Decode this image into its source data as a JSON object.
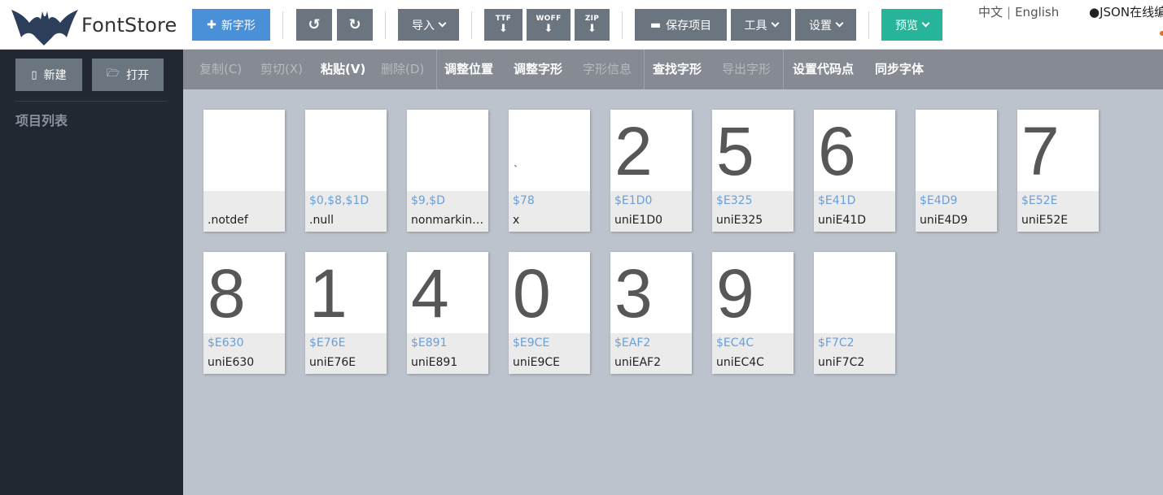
{
  "brand": {
    "name": "FontStore"
  },
  "toolbar": {
    "new_glyph": "新字形",
    "import": "导入",
    "ttf": "TTF",
    "woff": "WOFF",
    "zip": "ZIP",
    "save_project": "保存项目",
    "tools": "工具",
    "settings": "设置",
    "preview": "预览",
    "lang_zh": "中文",
    "lang_sep": "|",
    "lang_en": "English",
    "json_link": "JSON在线编辑"
  },
  "sidebar": {
    "new": "新建",
    "open": "打开",
    "projects_title": "项目列表"
  },
  "editbar": {
    "copy": "复制(C)",
    "cut": "剪切(X)",
    "paste": "粘贴(V)",
    "delete": "删除(D)",
    "adjust_pos": "调整位置",
    "adjust_glyph": "调整字形",
    "glyph_info": "字形信息",
    "find_glyph": "查找字形",
    "export_glyph": "导出字形",
    "set_codepoint": "设置代码点",
    "sync_font": "同步字体"
  },
  "glyphs": [
    {
      "char": "",
      "code": "",
      "name": ".notdef"
    },
    {
      "char": "",
      "code": "$0,$8,$1D",
      "name": ".null"
    },
    {
      "char": "",
      "code": "$9,$D",
      "name": "nonmarkingreturn"
    },
    {
      "char": "`",
      "code": "$78",
      "name": "x"
    },
    {
      "char": "2",
      "code": "$E1D0",
      "name": "uniE1D0"
    },
    {
      "char": "5",
      "code": "$E325",
      "name": "uniE325"
    },
    {
      "char": "6",
      "code": "$E41D",
      "name": "uniE41D"
    },
    {
      "char": "",
      "code": "$E4D9",
      "name": "uniE4D9"
    },
    {
      "char": "7",
      "code": "$E52E",
      "name": "uniE52E"
    },
    {
      "char": "8",
      "code": "$E630",
      "name": "uniE630"
    },
    {
      "char": "1",
      "code": "$E76E",
      "name": "uniE76E"
    },
    {
      "char": "4",
      "code": "$E891",
      "name": "uniE891"
    },
    {
      "char": "0",
      "code": "$E9CE",
      "name": "uniE9CE"
    },
    {
      "char": "3",
      "code": "$EAF2",
      "name": "uniEAF2"
    },
    {
      "char": "9",
      "code": "$EC4C",
      "name": "uniEC4C"
    },
    {
      "char": "",
      "code": "$F7C2",
      "name": "uniF7C2"
    }
  ]
}
